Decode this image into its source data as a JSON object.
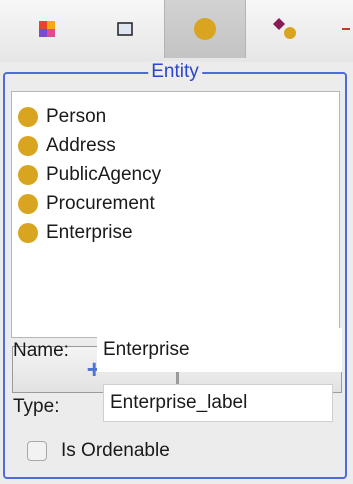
{
  "toolbar": {
    "tools": [
      {
        "icon": "palette-icon"
      },
      {
        "icon": "square-icon"
      },
      {
        "icon": "entity-circle-icon",
        "selected": true
      },
      {
        "icon": "relationship-icon"
      },
      {
        "icon": "overflow-icon"
      }
    ]
  },
  "entity": {
    "group_title": "Entity",
    "items": [
      {
        "label": "Person"
      },
      {
        "label": "Address"
      },
      {
        "label": "PublicAgency"
      },
      {
        "label": "Procurement"
      },
      {
        "label": "Enterprise"
      }
    ],
    "add_label": "+",
    "remove_label": "−",
    "name_label": "Name:",
    "name_value": "Enterprise",
    "type_label": "Type:",
    "type_value": "Enterprise_label",
    "ordenable_label": "Is Ordenable",
    "ordenable_checked": false
  },
  "colors": {
    "accent": "#4f6bd9",
    "entity_dot": "#d9a420"
  }
}
